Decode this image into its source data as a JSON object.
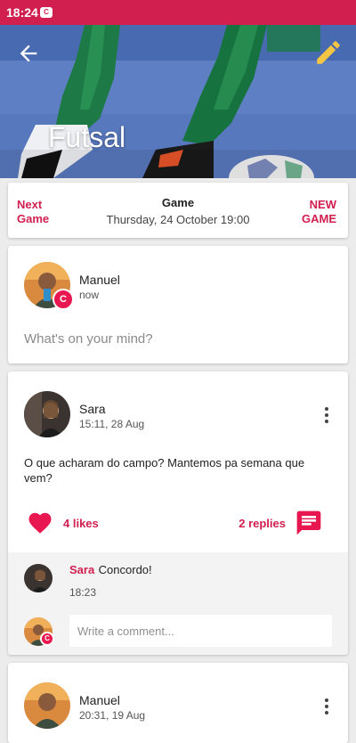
{
  "status_bar": {
    "time": "18:24",
    "app_icon": "C"
  },
  "header": {
    "title": "Futsal",
    "back_icon": "arrow-left",
    "edit_icon": "pencil",
    "accent": "#d11f4f"
  },
  "game_nav": {
    "next_label_line1": "Next",
    "next_label_line2": "Game",
    "game_title": "Game",
    "game_date": "Thursday, 24 October 19:00",
    "new_label_line1": "NEW",
    "new_label_line2": "GAME"
  },
  "composer": {
    "user_name": "Manuel",
    "time": "now",
    "badge": "C",
    "placeholder": "What's on your mind?"
  },
  "post": {
    "author": "Sara",
    "time": "15:11, 28 Aug",
    "body": "O que acharam do campo? Mantemos pa semana que vem?",
    "likes": "4 likes",
    "replies": "2 replies",
    "comment": {
      "author": "Sara",
      "text": "Concordo!",
      "time": "18:23"
    },
    "comment_badge": "C",
    "write_placeholder": "Write a comment..."
  },
  "post_next": {
    "author": "Manuel",
    "time": "20:31, 19 Aug"
  }
}
